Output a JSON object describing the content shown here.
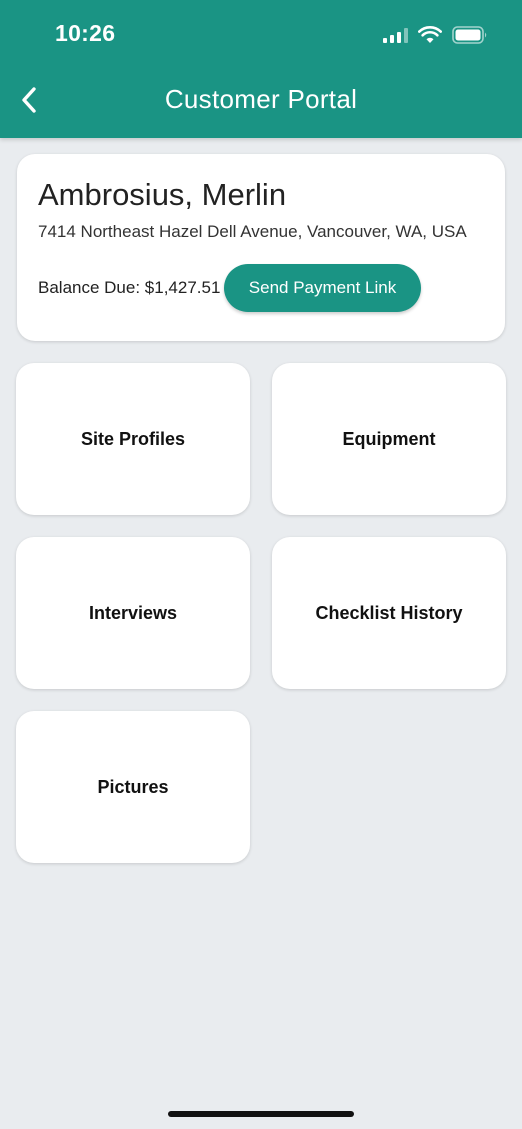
{
  "status_bar": {
    "time": "10:26",
    "icons": [
      "cellular-signal-icon",
      "wifi-icon",
      "battery-icon"
    ]
  },
  "header": {
    "title": "Customer Portal",
    "back_icon": "chevron-left-icon",
    "background_color": "#1A9484"
  },
  "customer": {
    "name": "Ambrosius, Merlin",
    "address": "7414 Northeast Hazel Dell Avenue, Vancouver, WA, USA",
    "balance_label": "Balance Due: $1,427.51",
    "send_payment_label": "Send Payment Link"
  },
  "tiles": [
    {
      "label": "Site Profiles"
    },
    {
      "label": "Equipment"
    },
    {
      "label": "Interviews"
    },
    {
      "label": "Checklist History"
    },
    {
      "label": "Pictures"
    }
  ],
  "colors": {
    "accent": "#1A9484",
    "background": "#E9ECEF",
    "card": "#FFFFFF"
  }
}
